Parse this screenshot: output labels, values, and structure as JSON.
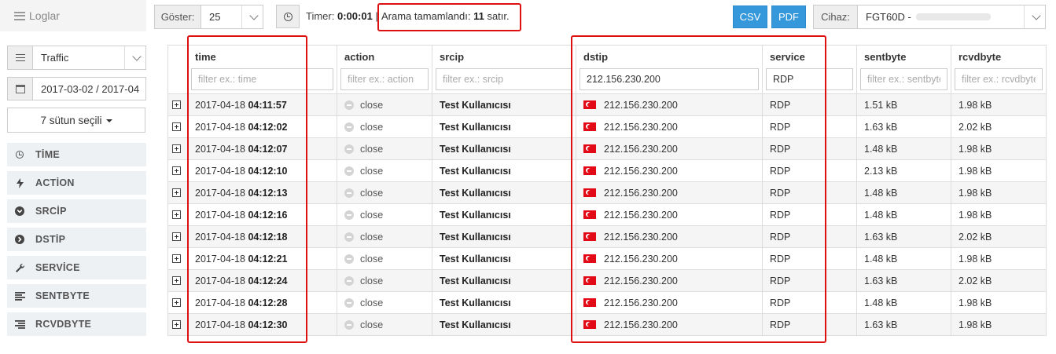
{
  "header": {
    "app_title": "Loglar",
    "show_label": "Göster:",
    "show_value": "25",
    "timer_label": "Timer:",
    "timer_value": "0:00:01",
    "timer_sep": "|",
    "status_text": "Arama tamamlandı:",
    "status_count": "11",
    "status_unit": "satır.",
    "csv_label": "CSV",
    "pdf_label": "PDF",
    "device_label": "Cihaz:",
    "device_value": "FGT60D -"
  },
  "sidebar": {
    "log_type": "Traffic",
    "date_range": "2017-03-02 / 2017-04",
    "columns_button": "7 sütun seçili",
    "items": [
      {
        "label": "TİME",
        "icon": "clock-icon"
      },
      {
        "label": "ACTİON",
        "icon": "bolt-icon"
      },
      {
        "label": "SRCİP",
        "icon": "chevron-circle-down-icon"
      },
      {
        "label": "DSTİP",
        "icon": "chevron-circle-right-icon"
      },
      {
        "label": "SERVİCE",
        "icon": "wrench-icon"
      },
      {
        "label": "SENTBYTE",
        "icon": "align-left-icon"
      },
      {
        "label": "RCVDBYTE",
        "icon": "align-right-icon"
      }
    ]
  },
  "table": {
    "columns": [
      "time",
      "action",
      "srcip",
      "dstip",
      "service",
      "sentbyte",
      "rcvdbyte"
    ],
    "filters": {
      "time": {
        "value": "",
        "placeholder": "filter ex.: time"
      },
      "action": {
        "value": "",
        "placeholder": "filter ex.: action"
      },
      "srcip": {
        "value": "",
        "placeholder": "filter ex.: srcip"
      },
      "dstip": {
        "value": "212.156.230.200",
        "placeholder": ""
      },
      "service": {
        "value": "RDP",
        "placeholder": ""
      },
      "sentbyte": {
        "value": "",
        "placeholder": "filter ex.: sentbyte"
      },
      "rcvdbyte": {
        "value": "",
        "placeholder": "filter ex.: rcvdbyte"
      }
    },
    "rows": [
      {
        "date": "2017-04-18",
        "clock": "04:11:57",
        "action": "close",
        "srcip": "Test Kullanıcısı",
        "dstip": "212.156.230.200",
        "service": "RDP",
        "sentbyte": "1.51 kB",
        "rcvdbyte": "1.98 kB"
      },
      {
        "date": "2017-04-18",
        "clock": "04:12:02",
        "action": "close",
        "srcip": "Test Kullanıcısı",
        "dstip": "212.156.230.200",
        "service": "RDP",
        "sentbyte": "1.63 kB",
        "rcvdbyte": "2.02 kB"
      },
      {
        "date": "2017-04-18",
        "clock": "04:12:07",
        "action": "close",
        "srcip": "Test Kullanıcısı",
        "dstip": "212.156.230.200",
        "service": "RDP",
        "sentbyte": "1.48 kB",
        "rcvdbyte": "1.98 kB"
      },
      {
        "date": "2017-04-18",
        "clock": "04:12:10",
        "action": "close",
        "srcip": "Test Kullanıcısı",
        "dstip": "212.156.230.200",
        "service": "RDP",
        "sentbyte": "2.13 kB",
        "rcvdbyte": "1.98 kB"
      },
      {
        "date": "2017-04-18",
        "clock": "04:12:13",
        "action": "close",
        "srcip": "Test Kullanıcısı",
        "dstip": "212.156.230.200",
        "service": "RDP",
        "sentbyte": "1.48 kB",
        "rcvdbyte": "1.98 kB"
      },
      {
        "date": "2017-04-18",
        "clock": "04:12:16",
        "action": "close",
        "srcip": "Test Kullanıcısı",
        "dstip": "212.156.230.200",
        "service": "RDP",
        "sentbyte": "1.48 kB",
        "rcvdbyte": "1.98 kB"
      },
      {
        "date": "2017-04-18",
        "clock": "04:12:18",
        "action": "close",
        "srcip": "Test Kullanıcısı",
        "dstip": "212.156.230.200",
        "service": "RDP",
        "sentbyte": "1.63 kB",
        "rcvdbyte": "2.02 kB"
      },
      {
        "date": "2017-04-18",
        "clock": "04:12:21",
        "action": "close",
        "srcip": "Test Kullanıcısı",
        "dstip": "212.156.230.200",
        "service": "RDP",
        "sentbyte": "1.48 kB",
        "rcvdbyte": "1.98 kB"
      },
      {
        "date": "2017-04-18",
        "clock": "04:12:24",
        "action": "close",
        "srcip": "Test Kullanıcısı",
        "dstip": "212.156.230.200",
        "service": "RDP",
        "sentbyte": "1.63 kB",
        "rcvdbyte": "2.02 kB"
      },
      {
        "date": "2017-04-18",
        "clock": "04:12:28",
        "action": "close",
        "srcip": "Test Kullanıcısı",
        "dstip": "212.156.230.200",
        "service": "RDP",
        "sentbyte": "1.48 kB",
        "rcvdbyte": "1.98 kB"
      },
      {
        "date": "2017-04-18",
        "clock": "04:12:30",
        "action": "close",
        "srcip": "Test Kullanıcısı",
        "dstip": "212.156.230.200",
        "service": "RDP",
        "sentbyte": "1.63 kB",
        "rcvdbyte": "1.98 kB"
      }
    ]
  },
  "colors": {
    "accent_blue": "#3498db",
    "highlight_red": "#dd1111",
    "flag_red": "#e30a17",
    "sidebar_bg": "#eef1f4"
  }
}
